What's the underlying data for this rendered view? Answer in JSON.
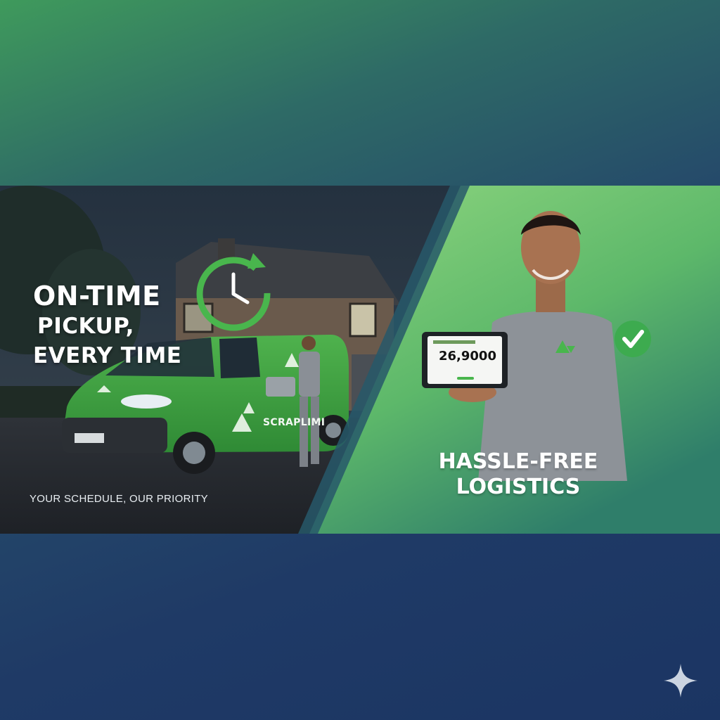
{
  "left": {
    "headline_line1": "ON-TIME",
    "headline_line2": "PICKUP,",
    "headline_line3": "EVERY TIME",
    "tagline": "YOUR SCHEDULE, OUR PRIORITY",
    "van_brand": "SCRAPLIMI"
  },
  "right": {
    "headline_line1": "HASSLE-FREE",
    "headline_line2": "LOGISTICS",
    "tablet_value": "26,9000"
  },
  "icons": {
    "clock": "clock-refresh-icon",
    "check": "check-circle-icon",
    "recycle": "recycle-icon",
    "sparkle": "sparkle-icon"
  },
  "colors": {
    "brand_green": "#3dab4f",
    "navy": "#1b3563",
    "light_green": "#7fce74"
  }
}
